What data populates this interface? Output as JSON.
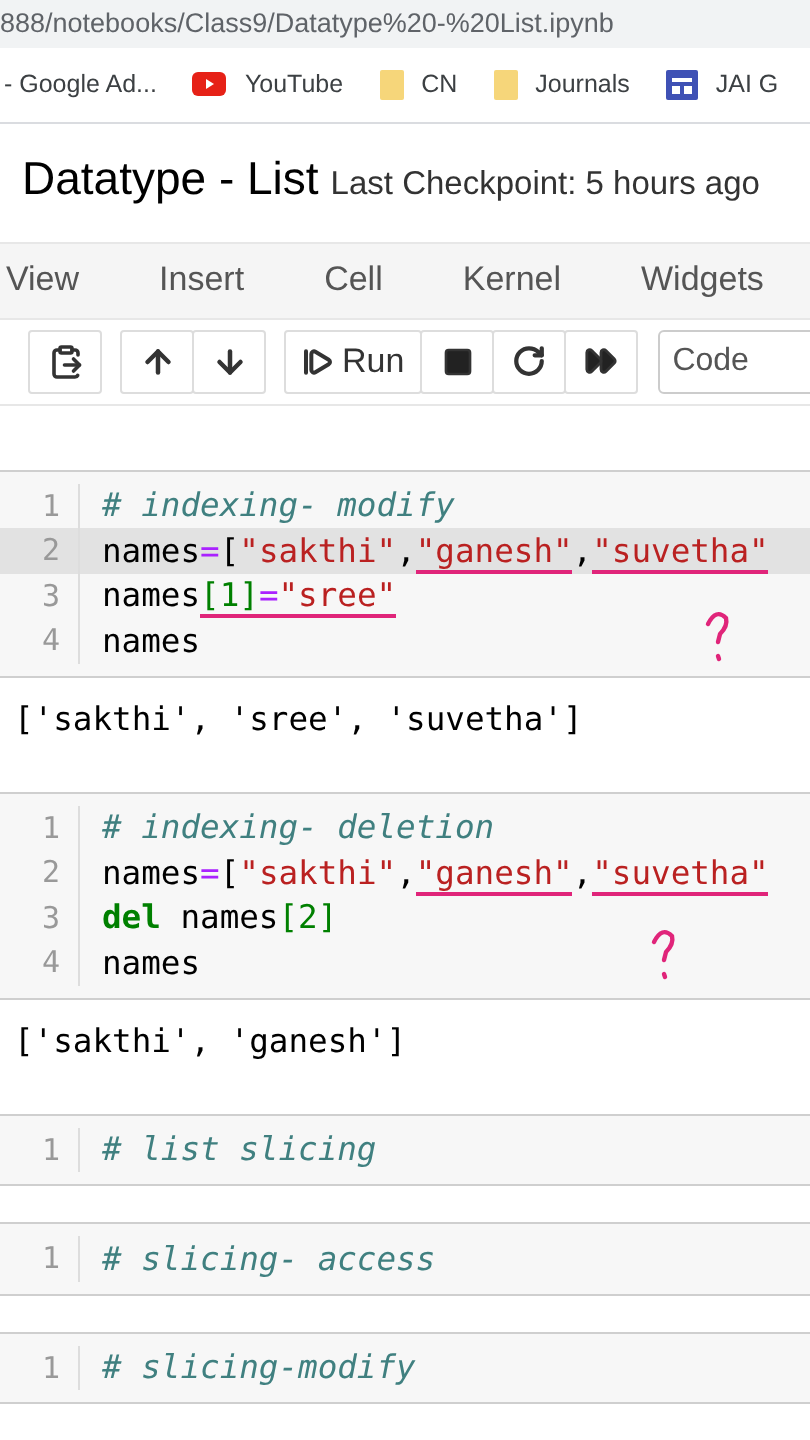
{
  "address_bar": {
    "url": "888/notebooks/Class9/Datatype%20-%20List.ipynb"
  },
  "bookmarks": [
    {
      "label": "- Google Ad...",
      "kind": "plain"
    },
    {
      "label": "YouTube",
      "kind": "video"
    },
    {
      "label": "CN",
      "kind": "folder"
    },
    {
      "label": "Journals",
      "kind": "folder"
    },
    {
      "label": "JAI G",
      "kind": "site"
    }
  ],
  "notebook": {
    "title": "Datatype - List",
    "checkpoint": "Last Checkpoint: 5 hours ago"
  },
  "menu": [
    "View",
    "Insert",
    "Cell",
    "Kernel",
    "Widgets"
  ],
  "toolbar": {
    "buttons": [
      {
        "kind": "paste"
      },
      {
        "kind": "up"
      },
      {
        "kind": "down"
      },
      {
        "kind": "run",
        "label": "Run"
      },
      {
        "kind": "stop"
      },
      {
        "kind": "restart"
      },
      {
        "kind": "run-all"
      }
    ],
    "cell_type": "Code"
  },
  "cells": [
    {
      "question_mark": true,
      "lines": [
        {
          "number": "1",
          "highlighted": false,
          "tokens": [
            {
              "kind": "comment",
              "text": "# indexing- modify",
              "underlined": false
            }
          ]
        },
        {
          "number": "2",
          "highlighted": true,
          "tokens": [
            {
              "kind": "name",
              "text": "names",
              "underlined": false
            },
            {
              "kind": "op",
              "text": "=",
              "underlined": false
            },
            {
              "kind": "name",
              "text": "[",
              "underlined": false
            },
            {
              "kind": "string",
              "text": "\"sakthi\"",
              "underlined": false
            },
            {
              "kind": "name",
              "text": ",",
              "underlined": false
            },
            {
              "kind": "string",
              "text": "\"ganesh\"",
              "underlined": true
            },
            {
              "kind": "name",
              "text": ",",
              "underlined": false
            },
            {
              "kind": "string",
              "text": "\"suvetha\"",
              "underlined": true
            }
          ]
        },
        {
          "number": "3",
          "highlighted": false,
          "tokens": [
            {
              "kind": "name",
              "text": "names",
              "underlined": false
            },
            {
              "kind": "number",
              "text": "[1]",
              "underlined": true
            },
            {
              "kind": "op",
              "text": "=",
              "underlined": true
            },
            {
              "kind": "string",
              "text": "\"sree\"",
              "underlined": true
            }
          ]
        },
        {
          "number": "4",
          "highlighted": false,
          "tokens": [
            {
              "kind": "name",
              "text": "names",
              "underlined": false
            }
          ]
        }
      ],
      "output": "['sakthi', 'sree', 'suvetha']"
    },
    {
      "question_mark": true,
      "lines": [
        {
          "number": "1",
          "highlighted": false,
          "tokens": [
            {
              "kind": "comment",
              "text": "# indexing- deletion",
              "underlined": false
            }
          ]
        },
        {
          "number": "2",
          "highlighted": false,
          "tokens": [
            {
              "kind": "name",
              "text": "names",
              "underlined": false
            },
            {
              "kind": "op",
              "text": "=",
              "underlined": false
            },
            {
              "kind": "name",
              "text": "[",
              "underlined": false
            },
            {
              "kind": "string",
              "text": "\"sakthi\"",
              "underlined": false
            },
            {
              "kind": "name",
              "text": ",",
              "underlined": false
            },
            {
              "kind": "string",
              "text": "\"ganesh\"",
              "underlined": true
            },
            {
              "kind": "name",
              "text": ",",
              "underlined": false
            },
            {
              "kind": "string",
              "text": "\"suvetha\"",
              "underlined": true
            }
          ]
        },
        {
          "number": "3",
          "highlighted": false,
          "tokens": [
            {
              "kind": "keyword",
              "text": "del",
              "underlined": false
            },
            {
              "kind": "name",
              "text": " names",
              "underlined": false
            },
            {
              "kind": "number",
              "text": "[2]",
              "underlined": false
            }
          ]
        },
        {
          "number": "4",
          "highlighted": false,
          "tokens": [
            {
              "kind": "name",
              "text": "names",
              "underlined": false
            }
          ]
        }
      ],
      "output": "['sakthi', 'ganesh']"
    },
    {
      "question_mark": false,
      "lines": [
        {
          "number": "1",
          "highlighted": false,
          "tokens": [
            {
              "kind": "comment",
              "text": "# list slicing",
              "underlined": false
            }
          ]
        }
      ]
    },
    {
      "question_mark": false,
      "lines": [
        {
          "number": "1",
          "highlighted": false,
          "tokens": [
            {
              "kind": "comment",
              "text": "# slicing- access",
              "underlined": false
            }
          ]
        }
      ]
    },
    {
      "question_mark": false,
      "lines": [
        {
          "number": "1",
          "highlighted": false,
          "tokens": [
            {
              "kind": "comment",
              "text": "# slicing-modify",
              "underlined": false
            }
          ]
        }
      ]
    }
  ]
}
